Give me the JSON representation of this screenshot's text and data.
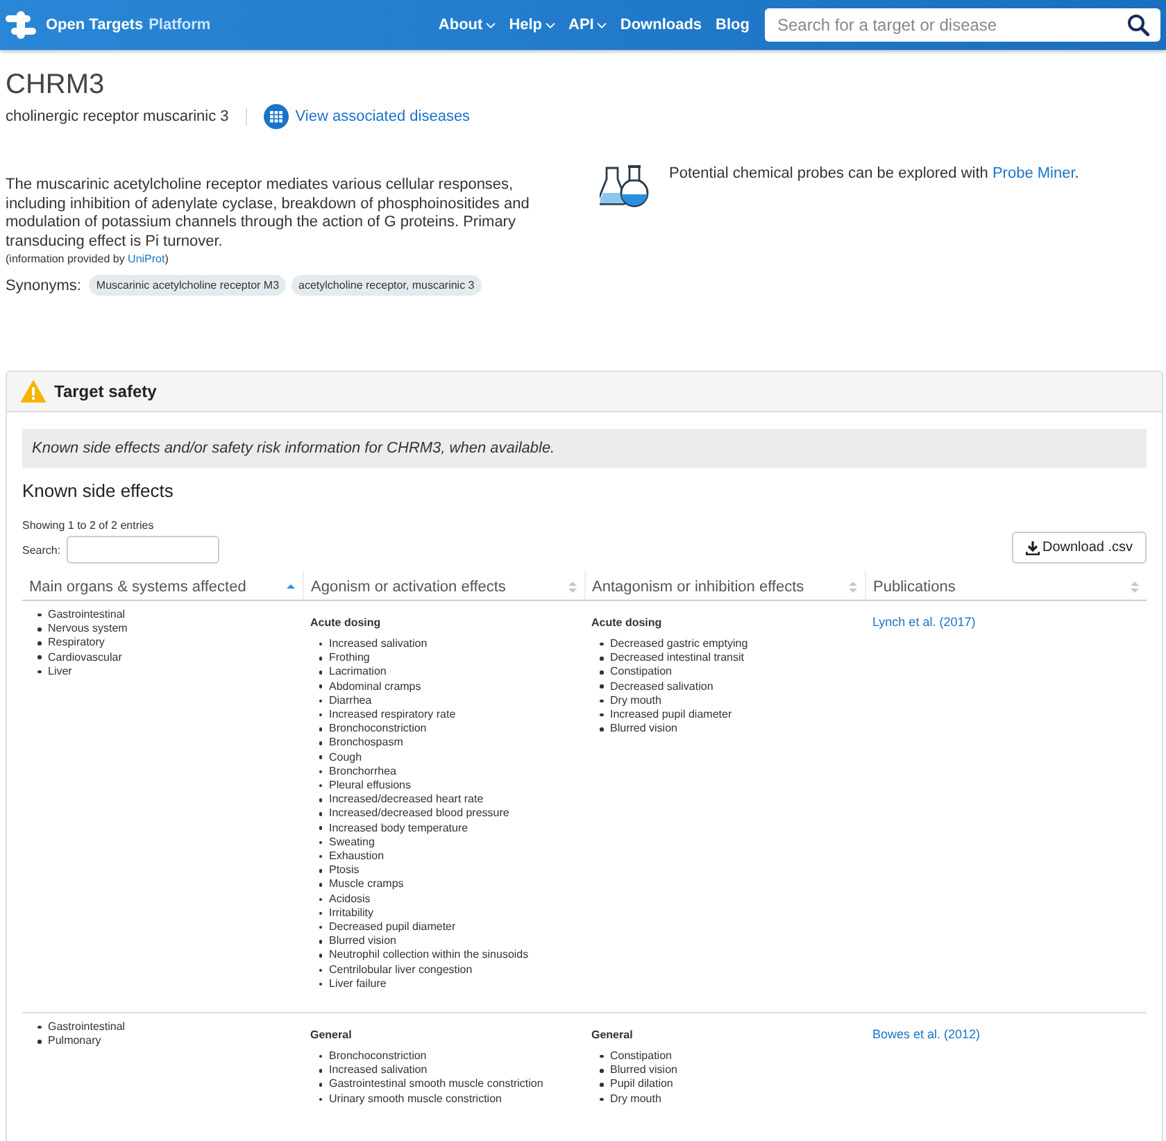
{
  "navbar": {
    "brand": "Open Targets",
    "brand_suffix": "Platform",
    "menu": [
      {
        "label": "About",
        "dropdown": true
      },
      {
        "label": "Help",
        "dropdown": true
      },
      {
        "label": "API",
        "dropdown": true
      },
      {
        "label": "Downloads",
        "dropdown": false
      },
      {
        "label": "Blog",
        "dropdown": false
      }
    ],
    "search": {
      "placeholder": "Search for a target or disease"
    }
  },
  "target": {
    "symbol": "CHRM3",
    "name": "cholinergic receptor muscarinic 3",
    "associations_link": "View associated diseases"
  },
  "description": {
    "text": "The muscarinic acetylcholine receptor mediates various cellular responses, including inhibition of adenylate cyclase, breakdown of phosphoinositides and modulation of potassium channels through the action of G proteins. Primary transducing effect is Pi turnover.",
    "source_prefix": "(information provided by ",
    "source_link": "UniProt",
    "source_suffix": ")",
    "synonyms_label": "Synonyms:",
    "synonyms": [
      "Muscarinic acetylcholine receptor M3",
      "acetylcholine receptor, muscarinic 3"
    ]
  },
  "probes": {
    "text": "Potential chemical probes can be explored with ",
    "link": "Probe Miner",
    "suffix": "."
  },
  "panel": {
    "title": "Target safety",
    "notice": "Known side effects and/or safety risk information for CHRM3, when available.",
    "section_title": "Known side effects",
    "entries_info": "Showing 1 to 2 of 2 entries",
    "search_label": "Search:",
    "download_button": "Download .csv",
    "table": {
      "columns": [
        {
          "label": "Main organs & systems affected",
          "sorted_ascending": true
        },
        {
          "label": "Agonism or activation effects",
          "sorted_ascending": false
        },
        {
          "label": "Antagonism or inhibition effects",
          "sorted_ascending": false
        },
        {
          "label": "Publications",
          "sorted_ascending": false
        }
      ],
      "rows": [
        {
          "organs": [
            "Gastrointestinal",
            "Nervous system",
            "Respiratory",
            "Cardiovascular",
            "Liver"
          ],
          "agonism": {
            "heading": "Acute dosing",
            "effects": [
              "Increased salivation",
              "Frothing",
              "Lacrimation",
              "Abdominal cramps",
              "Diarrhea",
              "Increased respiratory rate",
              "Bronchoconstriction",
              "Bronchospasm",
              "Cough",
              "Bronchorrhea",
              "Pleural effusions",
              "Increased/decreased heart rate",
              "Increased/decreased blood pressure",
              "Increased body temperature",
              "Sweating",
              "Exhaustion",
              "Ptosis",
              "Muscle cramps",
              "Acidosis",
              "Irritability",
              "Decreased pupil diameter",
              "Blurred vision",
              "Neutrophil collection within the sinusoids",
              "Centrilobular liver congestion",
              "Liver failure"
            ]
          },
          "antagonism": {
            "heading": "Acute dosing",
            "effects": [
              "Decreased gastric emptying",
              "Decreased intestinal transit",
              "Constipation",
              "Decreased salivation",
              "Dry mouth",
              "Increased pupil diameter",
              "Blurred vision"
            ]
          },
          "publication": "Lynch et al. (2017)"
        },
        {
          "organs": [
            "Gastrointestinal",
            "Pulmonary"
          ],
          "agonism": {
            "heading": "General",
            "effects": [
              "Bronchoconstriction",
              "Increased salivation",
              "Gastrointestinal smooth muscle constriction",
              "Urinary smooth muscle constriction"
            ]
          },
          "antagonism": {
            "heading": "General",
            "effects": [
              "Constipation",
              "Blurred vision",
              "Pupil dilation",
              "Dry mouth"
            ]
          },
          "publication": "Bowes et al. (2012)"
        }
      ]
    }
  }
}
